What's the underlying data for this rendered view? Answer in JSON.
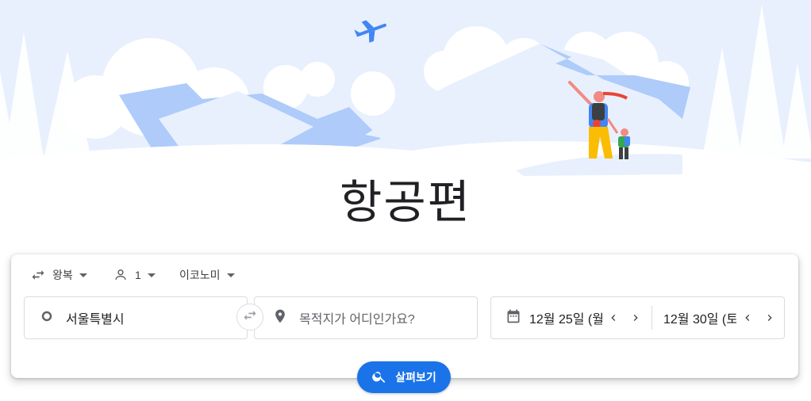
{
  "page": {
    "title": "항공편"
  },
  "options": {
    "trip_type": "왕복",
    "passengers": "1",
    "cabin_class": "이코노미"
  },
  "search": {
    "origin": "서울특별시",
    "destination_placeholder": "목적지가 어디인가요?",
    "depart_date": "12월 25일 (월",
    "return_date": "12월 30일 (토",
    "button_label": "살펴보기"
  },
  "icons": {
    "trip_type": "swap-arrows-icon",
    "passengers": "person-icon",
    "origin": "circle-icon",
    "swap": "swap-arrows-icon",
    "destination": "location-pin-icon",
    "date": "calendar-icon",
    "prev": "chevron-left-icon",
    "next": "chevron-right-icon",
    "search": "search-icon"
  },
  "colors": {
    "accent": "#1a73e8",
    "sky": "#e8f0fe",
    "mountain": "#aecbfa"
  }
}
